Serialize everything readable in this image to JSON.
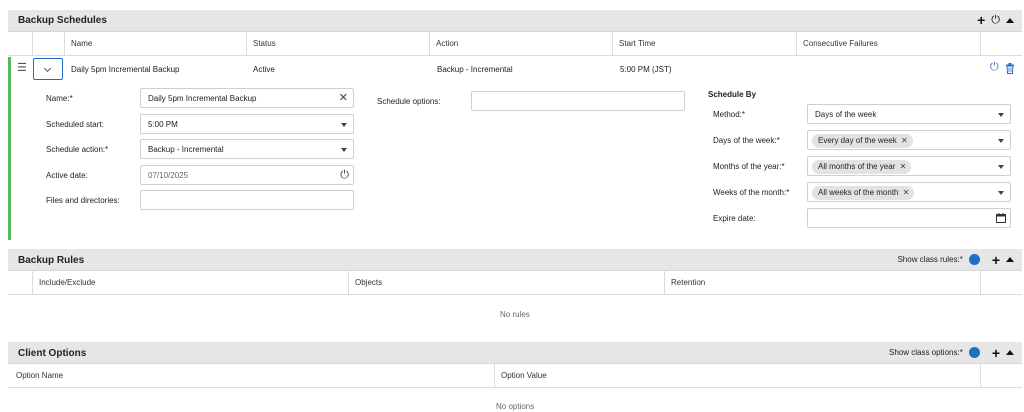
{
  "backup_schedules": {
    "title": "Backup Schedules",
    "columns": [
      "Name",
      "Status",
      "Action",
      "Start Time",
      "Consecutive Failures"
    ],
    "row": {
      "name": "Daily 5pm Incremental Backup",
      "status": "Active",
      "action": "Backup - Incremental",
      "start_time": "5:00 PM (JST)",
      "consecutive_failures": ""
    },
    "form": {
      "name_label": "Name:*",
      "name_value": "Daily 5pm Incremental Backup",
      "scheduled_start_label": "Scheduled start:",
      "scheduled_start_value": "5:00 PM",
      "schedule_action_label": "Schedule action:*",
      "schedule_action_value": "Backup - Incremental",
      "active_date_label": "Active date:",
      "active_date_value": "07/10/2025",
      "files_label": "Files and directories:",
      "files_value": "",
      "schedule_options_label": "Schedule options:",
      "schedule_options_value": ""
    },
    "schedule_by": {
      "heading": "Schedule By",
      "method_label": "Method:*",
      "method_value": "Days of the week",
      "days_label": "Days of the week:*",
      "days_chip": "Every day of the week",
      "months_label": "Months of the year:*",
      "months_chip": "All months of the year",
      "weeks_label": "Weeks of the month:*",
      "weeks_chip": "All weeks of the month",
      "expire_label": "Expire date:",
      "expire_value": ""
    }
  },
  "backup_rules": {
    "title": "Backup Rules",
    "show_class_label": "Show class rules:*",
    "columns": [
      "Include/Exclude",
      "Objects",
      "Retention"
    ],
    "empty": "No rules"
  },
  "client_options": {
    "title": "Client Options",
    "show_class_label": "Show class options:*",
    "columns": [
      "Option Name",
      "Option Value"
    ],
    "empty": "No options"
  },
  "colors": {
    "accent": "#1f6fc5",
    "row_marker": "#5cb85c",
    "header_bg": "#e6e6e6"
  }
}
